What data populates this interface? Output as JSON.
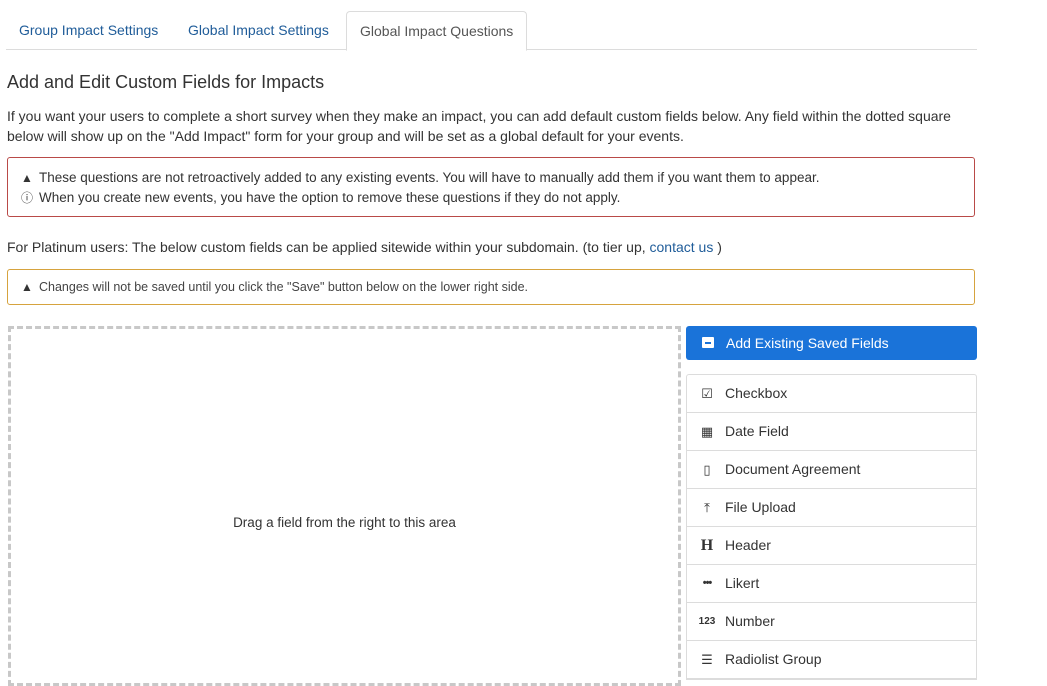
{
  "tabs": [
    {
      "label": "Group Impact Settings",
      "active": false
    },
    {
      "label": "Global Impact Settings",
      "active": false
    },
    {
      "label": "Global Impact Questions",
      "active": true
    }
  ],
  "heading": "Add and Edit Custom Fields for Impacts",
  "intro": "If you want your users to complete a short survey when they make an impact, you can add default custom fields below. Any field within the dotted square below will show up on the \"Add Impact\" form for your group and will be set as a global default for your events.",
  "alert_red": {
    "line1": "These questions are not retroactively added to any existing events. You will have to manually add them if you want them to appear.",
    "line2": "When you create new events, you have the option to remove these questions if they do not apply."
  },
  "platinum": {
    "text": "For Platinum users: The below custom fields can be applied sitewide within your subdomain. (to tier up,",
    "link": "contact us",
    "close": ")"
  },
  "alert_yellow": "Changes will not be saved until you click the \"Save\" button below on the lower right side.",
  "dropzone_message": "Drag a field from the right to this area",
  "add_existing_button": "Add Existing Saved Fields",
  "fields": [
    {
      "label": "Checkbox",
      "icon": "checkbox-icon"
    },
    {
      "label": "Date Field",
      "icon": "calendar-icon"
    },
    {
      "label": "Document Agreement",
      "icon": "document-icon"
    },
    {
      "label": "File Upload",
      "icon": "upload-icon"
    },
    {
      "label": "Header",
      "icon": "header-icon"
    },
    {
      "label": "Likert",
      "icon": "ellipsis-icon"
    },
    {
      "label": "Number",
      "icon": "number-icon"
    },
    {
      "label": "Radiolist Group",
      "icon": "list-icon"
    }
  ],
  "colors": {
    "accent": "#1a73d9",
    "link": "#1f5c99",
    "alert_red_border": "#b94a48",
    "alert_yellow_border": "#d6a33e"
  }
}
